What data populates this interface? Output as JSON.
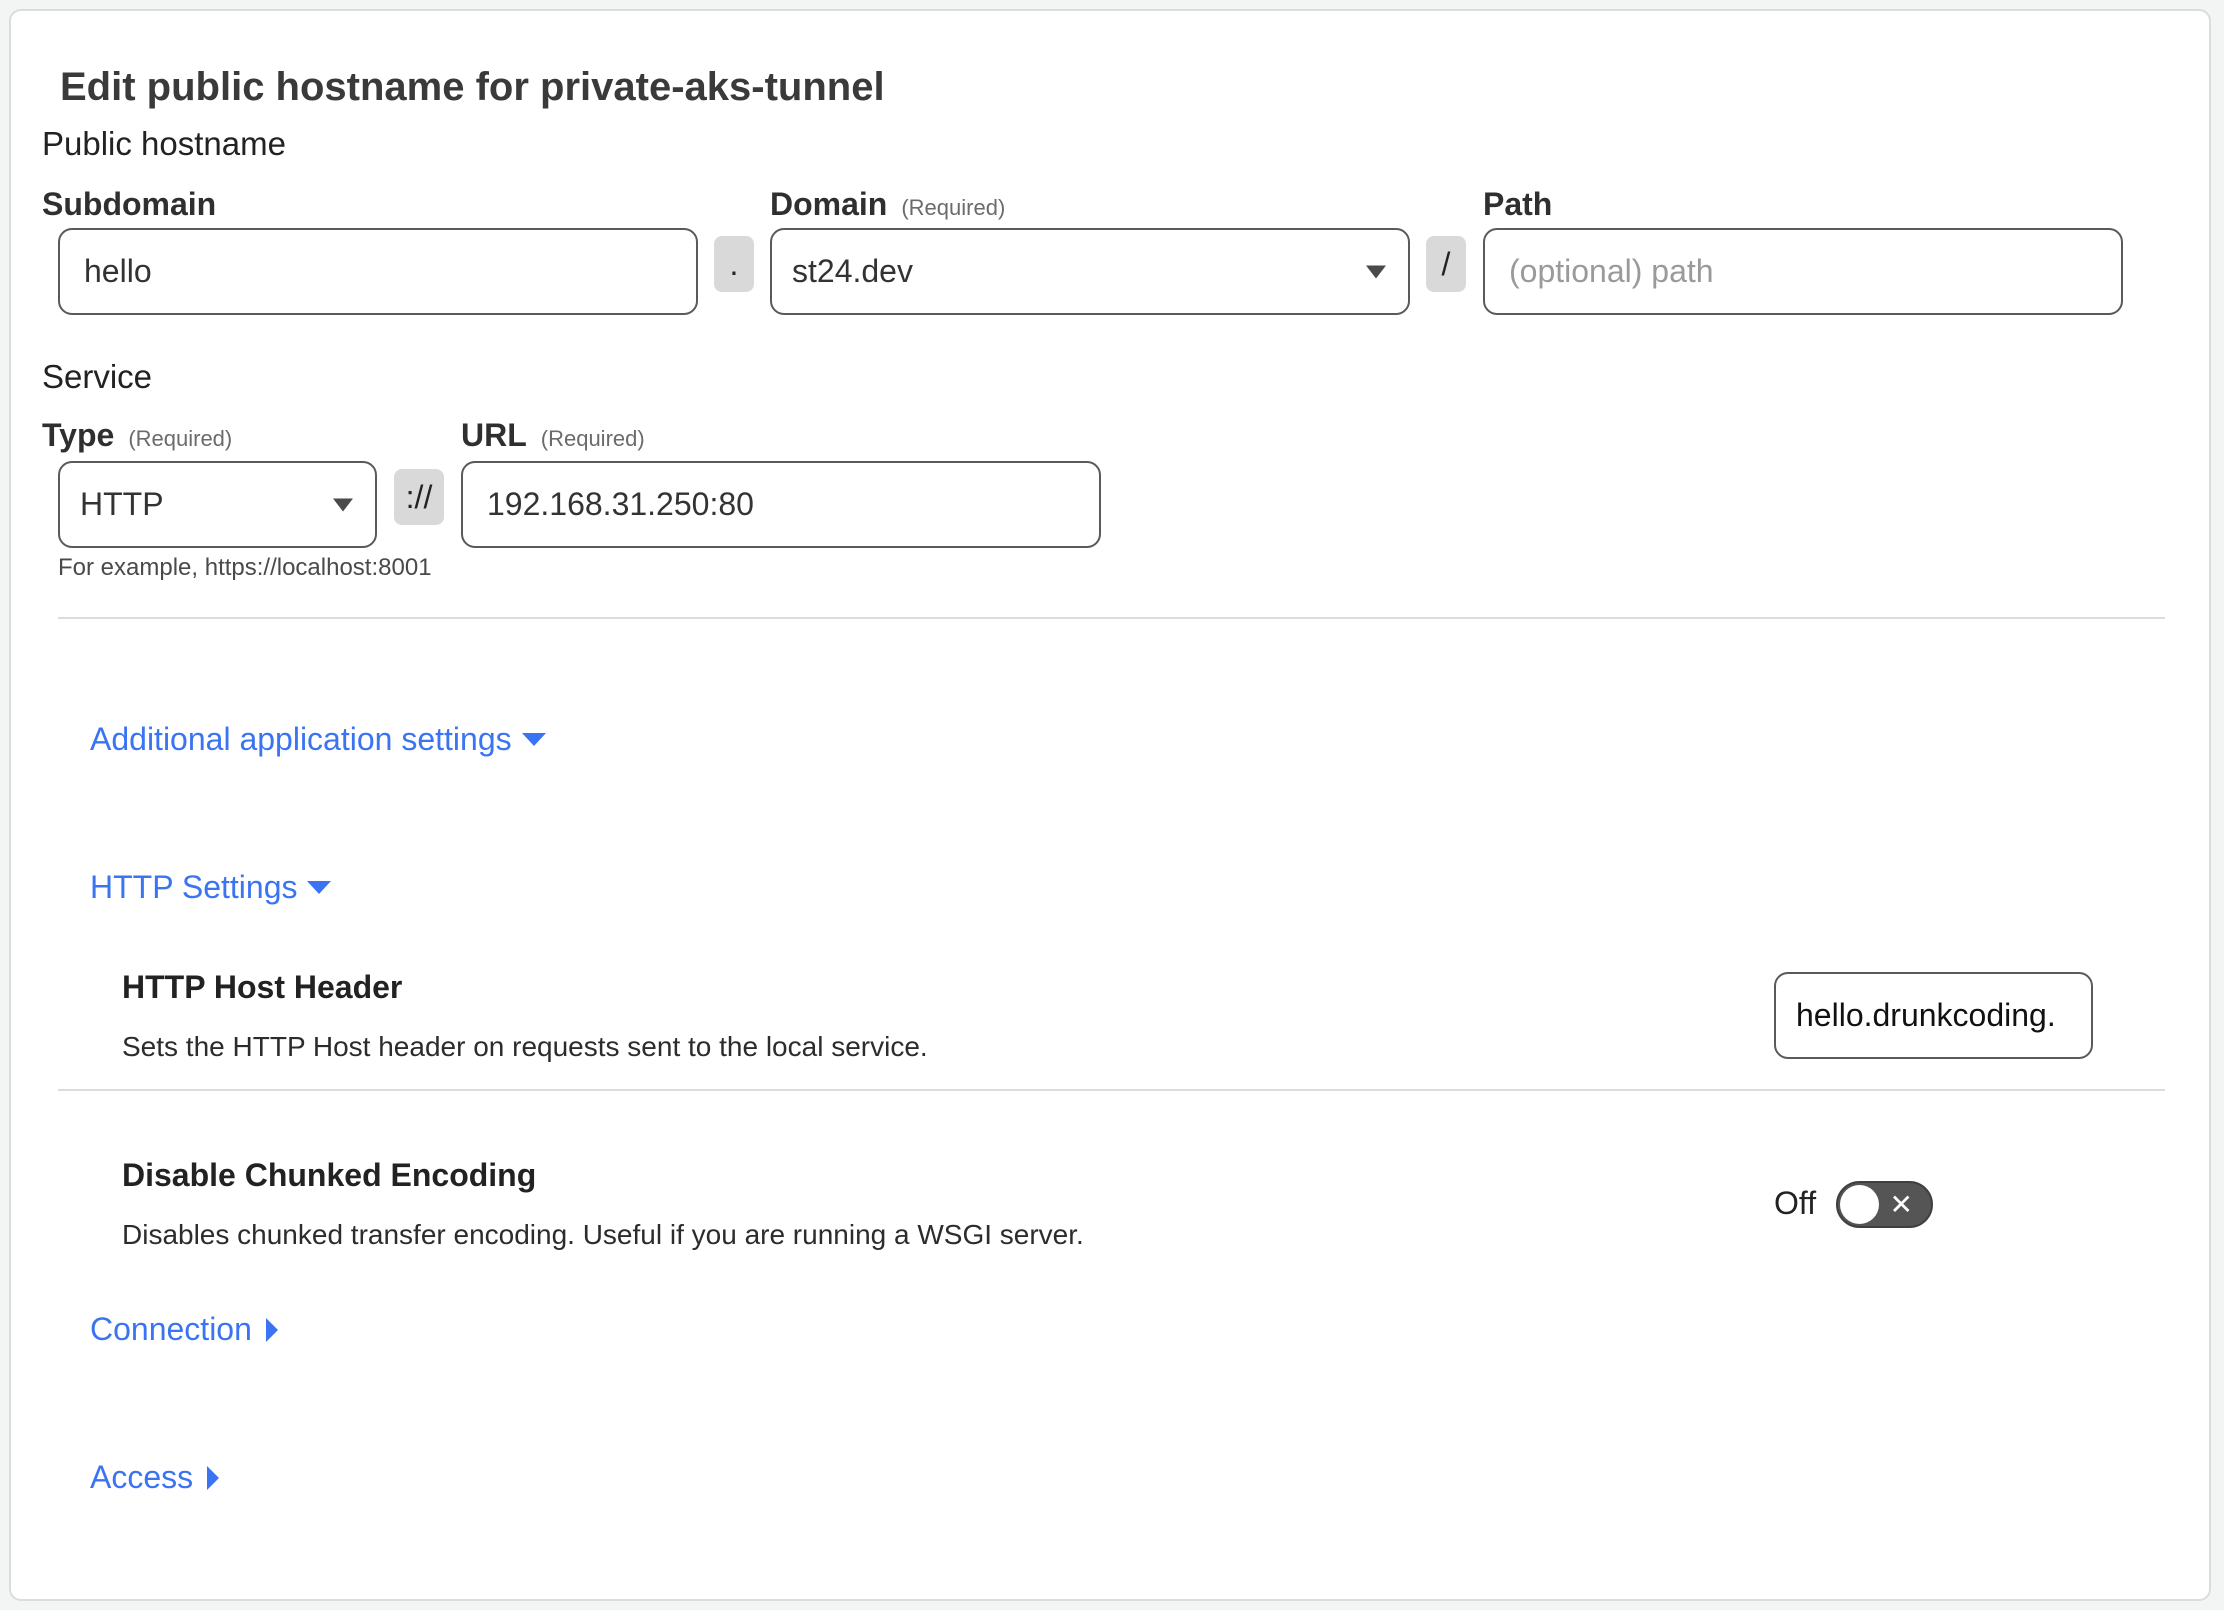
{
  "page": {
    "title": "Edit public hostname for private-aks-tunnel"
  },
  "public_hostname": {
    "section_label": "Public hostname",
    "subdomain": {
      "label": "Subdomain",
      "value": "hello"
    },
    "dot_separator": ".",
    "domain": {
      "label": "Domain",
      "required_note": "(Required)",
      "selected": "st24.dev"
    },
    "slash_separator": "/",
    "path": {
      "label": "Path",
      "value": "",
      "placeholder": "(optional) path"
    }
  },
  "service": {
    "section_label": "Service",
    "type": {
      "label": "Type",
      "required_note": "(Required)",
      "selected": "HTTP"
    },
    "scheme_separator": "://",
    "url": {
      "label": "URL",
      "required_note": "(Required)",
      "value": "192.168.31.250:80"
    },
    "helper_text": "For example, https://localhost:8001"
  },
  "additional_settings": {
    "label": "Additional application settings",
    "expanded": true,
    "http_settings": {
      "label": "HTTP Settings",
      "expanded": true,
      "host_header": {
        "title": "HTTP Host Header",
        "description": "Sets the HTTP Host header on requests sent to the local service.",
        "value": "hello.drunkcoding."
      },
      "disable_chunked": {
        "title": "Disable Chunked Encoding",
        "description": "Disables chunked transfer encoding. Useful if you are running a WSGI server.",
        "state_label": "Off",
        "enabled": false
      }
    },
    "connection": {
      "label": "Connection",
      "expanded": false
    },
    "access": {
      "label": "Access",
      "expanded": false
    }
  },
  "colors": {
    "link": "#3b74f2",
    "toggle_off": "#555555",
    "chip_bg": "#d9d9d9"
  }
}
